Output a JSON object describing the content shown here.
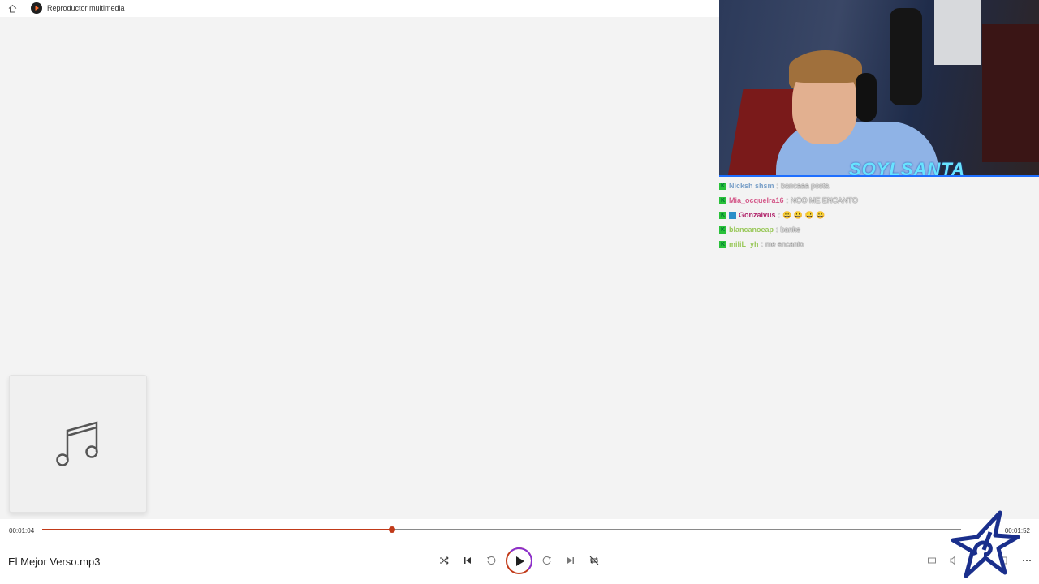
{
  "app": {
    "title": "Reproductor multimedia",
    "home_icon": "home-icon",
    "app_icon": "media-player-icon"
  },
  "now_playing": {
    "file_name": "El Mejor Verso.mp3",
    "art_icon": "music-note-icon",
    "elapsed": "00:01:04",
    "total": "00:01:52",
    "progress_fraction": 0.381
  },
  "controls": {
    "shuffle": "shuffle-icon",
    "previous": "previous-icon",
    "rewind": "rewind-10-icon",
    "play": "play-icon",
    "forward": "forward-30-icon",
    "next": "next-icon",
    "repeat": "repeat-icon",
    "miniplayer": "miniplayer-icon",
    "volume": "volume-icon",
    "cast": "cast-icon",
    "more": "more-icon"
  },
  "overlay": {
    "webcam_logo": "SOYLSANTA",
    "chat": [
      {
        "user": "Nicksh shsm",
        "message": "bancaaa posta",
        "user_color": "#7aa0c8",
        "badges": [
          "K"
        ]
      },
      {
        "user": "Mia_ocquelra16",
        "message": "NOO ME ENCANTO",
        "user_color": "#d45a8a",
        "badges": [
          "K"
        ]
      },
      {
        "user": "Gonzalvus",
        "message": "😀 😀 😀 😀",
        "user_color": "#b0256b",
        "badges": [
          "K",
          "sub"
        ]
      },
      {
        "user": "blancanoeap",
        "message": "banke",
        "user_color": "#9ac85a",
        "badges": [
          "K"
        ]
      },
      {
        "user": "miliL_yh",
        "message": "me encanto",
        "user_color": "#9ac85a",
        "badges": [
          "K"
        ]
      }
    ]
  },
  "colors": {
    "accent": "#c13a19",
    "play_ring_gradient": "#8a2fd0",
    "background": "#f3f3f3",
    "bar": "#ffffff"
  }
}
